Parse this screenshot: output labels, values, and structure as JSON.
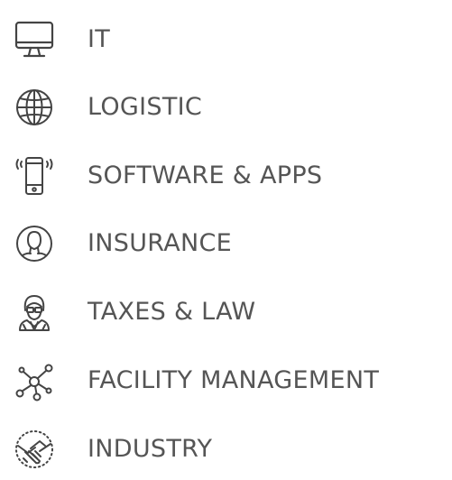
{
  "colors": {
    "text": "#555555",
    "icon_stroke": "#444444"
  },
  "industries": [
    {
      "label": "IT",
      "icon": "desktop-monitor-icon"
    },
    {
      "label": "LOGISTIC",
      "icon": "globe-icon"
    },
    {
      "label": "SOFTWARE & APPS",
      "icon": "smartphone-vibrate-icon"
    },
    {
      "label": "INSURANCE",
      "icon": "person-circle-icon"
    },
    {
      "label": "TAXES & LAW",
      "icon": "lawyer-woman-icon"
    },
    {
      "label": "FACILITY MANAGEMENT",
      "icon": "network-nodes-icon"
    },
    {
      "label": "INDUSTRY",
      "icon": "handshake-icon"
    }
  ]
}
